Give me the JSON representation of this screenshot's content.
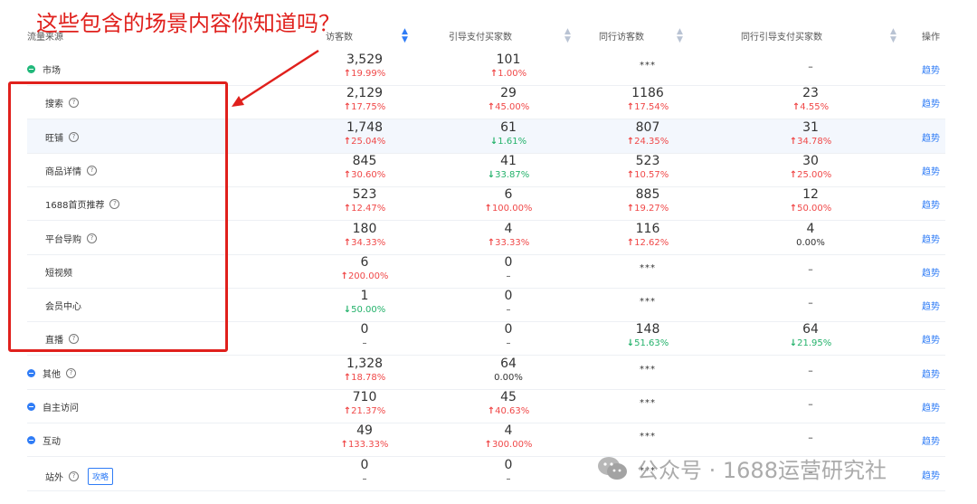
{
  "annotation": {
    "text": "这些包含的场景内容你知道吗？"
  },
  "header": {
    "source": "流量来源",
    "visitors": "访客数",
    "guide_buyers": "引导支付买家数",
    "peer_visitors": "同行访客数",
    "peer_guide_buyers": "同行引导支付买家数",
    "action": "操作"
  },
  "rows": [
    {
      "source": "市场",
      "dot": "green",
      "help": false,
      "visitors": "3,529",
      "visitors_pct": "19.99%",
      "visitors_dir": "up",
      "buyers": "101",
      "buyers_pct": "1.00%",
      "buyers_dir": "up",
      "peer_visitors": "***",
      "peer_visitors_pct": "",
      "peer_visitors_dir": "",
      "peer_buyers": "–",
      "peer_buyers_pct": "",
      "peer_buyers_dir": "",
      "action": "趋势"
    },
    {
      "source": "搜索",
      "dot": "",
      "help": true,
      "visitors": "2,129",
      "visitors_pct": "17.75%",
      "visitors_dir": "up",
      "buyers": "29",
      "buyers_pct": "45.00%",
      "buyers_dir": "up",
      "peer_visitors": "1186",
      "peer_visitors_pct": "17.54%",
      "peer_visitors_dir": "up",
      "peer_buyers": "23",
      "peer_buyers_pct": "4.55%",
      "peer_buyers_dir": "up",
      "action": "趋势"
    },
    {
      "source": "旺铺",
      "dot": "",
      "help": true,
      "visitors": "1,748",
      "visitors_pct": "25.04%",
      "visitors_dir": "up",
      "buyers": "61",
      "buyers_pct": "1.61%",
      "buyers_dir": "down",
      "peer_visitors": "807",
      "peer_visitors_pct": "24.35%",
      "peer_visitors_dir": "up",
      "peer_buyers": "31",
      "peer_buyers_pct": "34.78%",
      "peer_buyers_dir": "up",
      "action": "趋势"
    },
    {
      "source": "商品详情",
      "dot": "",
      "help": true,
      "visitors": "845",
      "visitors_pct": "30.60%",
      "visitors_dir": "up",
      "buyers": "41",
      "buyers_pct": "33.87%",
      "buyers_dir": "down",
      "peer_visitors": "523",
      "peer_visitors_pct": "10.57%",
      "peer_visitors_dir": "up",
      "peer_buyers": "30",
      "peer_buyers_pct": "25.00%",
      "peer_buyers_dir": "up",
      "action": "趋势"
    },
    {
      "source": "1688首页推荐",
      "dot": "",
      "help": true,
      "visitors": "523",
      "visitors_pct": "12.47%",
      "visitors_dir": "up",
      "buyers": "6",
      "buyers_pct": "100.00%",
      "buyers_dir": "up",
      "peer_visitors": "885",
      "peer_visitors_pct": "19.27%",
      "peer_visitors_dir": "up",
      "peer_buyers": "12",
      "peer_buyers_pct": "50.00%",
      "peer_buyers_dir": "up",
      "action": "趋势"
    },
    {
      "source": "平台导购",
      "dot": "",
      "help": true,
      "visitors": "180",
      "visitors_pct": "34.33%",
      "visitors_dir": "up",
      "buyers": "4",
      "buyers_pct": "33.33%",
      "buyers_dir": "up",
      "peer_visitors": "116",
      "peer_visitors_pct": "12.62%",
      "peer_visitors_dir": "up",
      "peer_buyers": "4",
      "peer_buyers_pct": "0.00%",
      "peer_buyers_dir": "flat",
      "action": "趋势"
    },
    {
      "source": "短视频",
      "dot": "",
      "help": false,
      "visitors": "6",
      "visitors_pct": "200.00%",
      "visitors_dir": "up",
      "buyers": "0",
      "buyers_pct": "–",
      "buyers_dir": "flat",
      "peer_visitors": "***",
      "peer_visitors_pct": "",
      "peer_visitors_dir": "",
      "peer_buyers": "–",
      "peer_buyers_pct": "",
      "peer_buyers_dir": "",
      "action": "趋势"
    },
    {
      "source": "会员中心",
      "dot": "",
      "help": false,
      "visitors": "1",
      "visitors_pct": "50.00%",
      "visitors_dir": "down",
      "buyers": "0",
      "buyers_pct": "–",
      "buyers_dir": "flat",
      "peer_visitors": "***",
      "peer_visitors_pct": "",
      "peer_visitors_dir": "",
      "peer_buyers": "–",
      "peer_buyers_pct": "",
      "peer_buyers_dir": "",
      "action": "趋势"
    },
    {
      "source": "直播",
      "dot": "",
      "help": true,
      "visitors": "0",
      "visitors_pct": "–",
      "visitors_dir": "flat",
      "buyers": "0",
      "buyers_pct": "–",
      "buyers_dir": "flat",
      "peer_visitors": "148",
      "peer_visitors_pct": "51.63%",
      "peer_visitors_dir": "down",
      "peer_buyers": "64",
      "peer_buyers_pct": "21.95%",
      "peer_buyers_dir": "down",
      "action": "趋势"
    },
    {
      "source": "其他",
      "dot": "blue",
      "help": true,
      "visitors": "1,328",
      "visitors_pct": "18.78%",
      "visitors_dir": "up",
      "buyers": "64",
      "buyers_pct": "0.00%",
      "buyers_dir": "flat",
      "peer_visitors": "***",
      "peer_visitors_pct": "",
      "peer_visitors_dir": "",
      "peer_buyers": "–",
      "peer_buyers_pct": "",
      "peer_buyers_dir": "",
      "action": "趋势"
    },
    {
      "source": "自主访问",
      "dot": "blue",
      "help": false,
      "visitors": "710",
      "visitors_pct": "21.37%",
      "visitors_dir": "up",
      "buyers": "45",
      "buyers_pct": "40.63%",
      "buyers_dir": "up",
      "peer_visitors": "***",
      "peer_visitors_pct": "",
      "peer_visitors_dir": "",
      "peer_buyers": "–",
      "peer_buyers_pct": "",
      "peer_buyers_dir": "",
      "action": "趋势"
    },
    {
      "source": "互动",
      "dot": "blue",
      "help": false,
      "visitors": "49",
      "visitors_pct": "133.33%",
      "visitors_dir": "up",
      "buyers": "4",
      "buyers_pct": "300.00%",
      "buyers_dir": "up",
      "peer_visitors": "***",
      "peer_visitors_pct": "",
      "peer_visitors_dir": "",
      "peer_buyers": "–",
      "peer_buyers_pct": "",
      "peer_buyers_dir": "",
      "action": "趋势"
    },
    {
      "source": "站外",
      "dot": "",
      "help": true,
      "tag": "攻略",
      "visitors": "0",
      "visitors_pct": "–",
      "visitors_dir": "flat",
      "buyers": "0",
      "buyers_pct": "–",
      "buyers_dir": "flat",
      "peer_visitors": "***",
      "peer_visitors_pct": "",
      "peer_visitors_dir": "",
      "peer_buyers": "–",
      "peer_buyers_pct": "",
      "peer_buyers_dir": "",
      "action": "趋势"
    }
  ],
  "watermark": {
    "text": "公众号 · 1688运营研究社"
  },
  "colors": {
    "up": "#f04848",
    "down": "#24b26b",
    "link": "#2f7cf6",
    "annotation": "#e0201c"
  }
}
